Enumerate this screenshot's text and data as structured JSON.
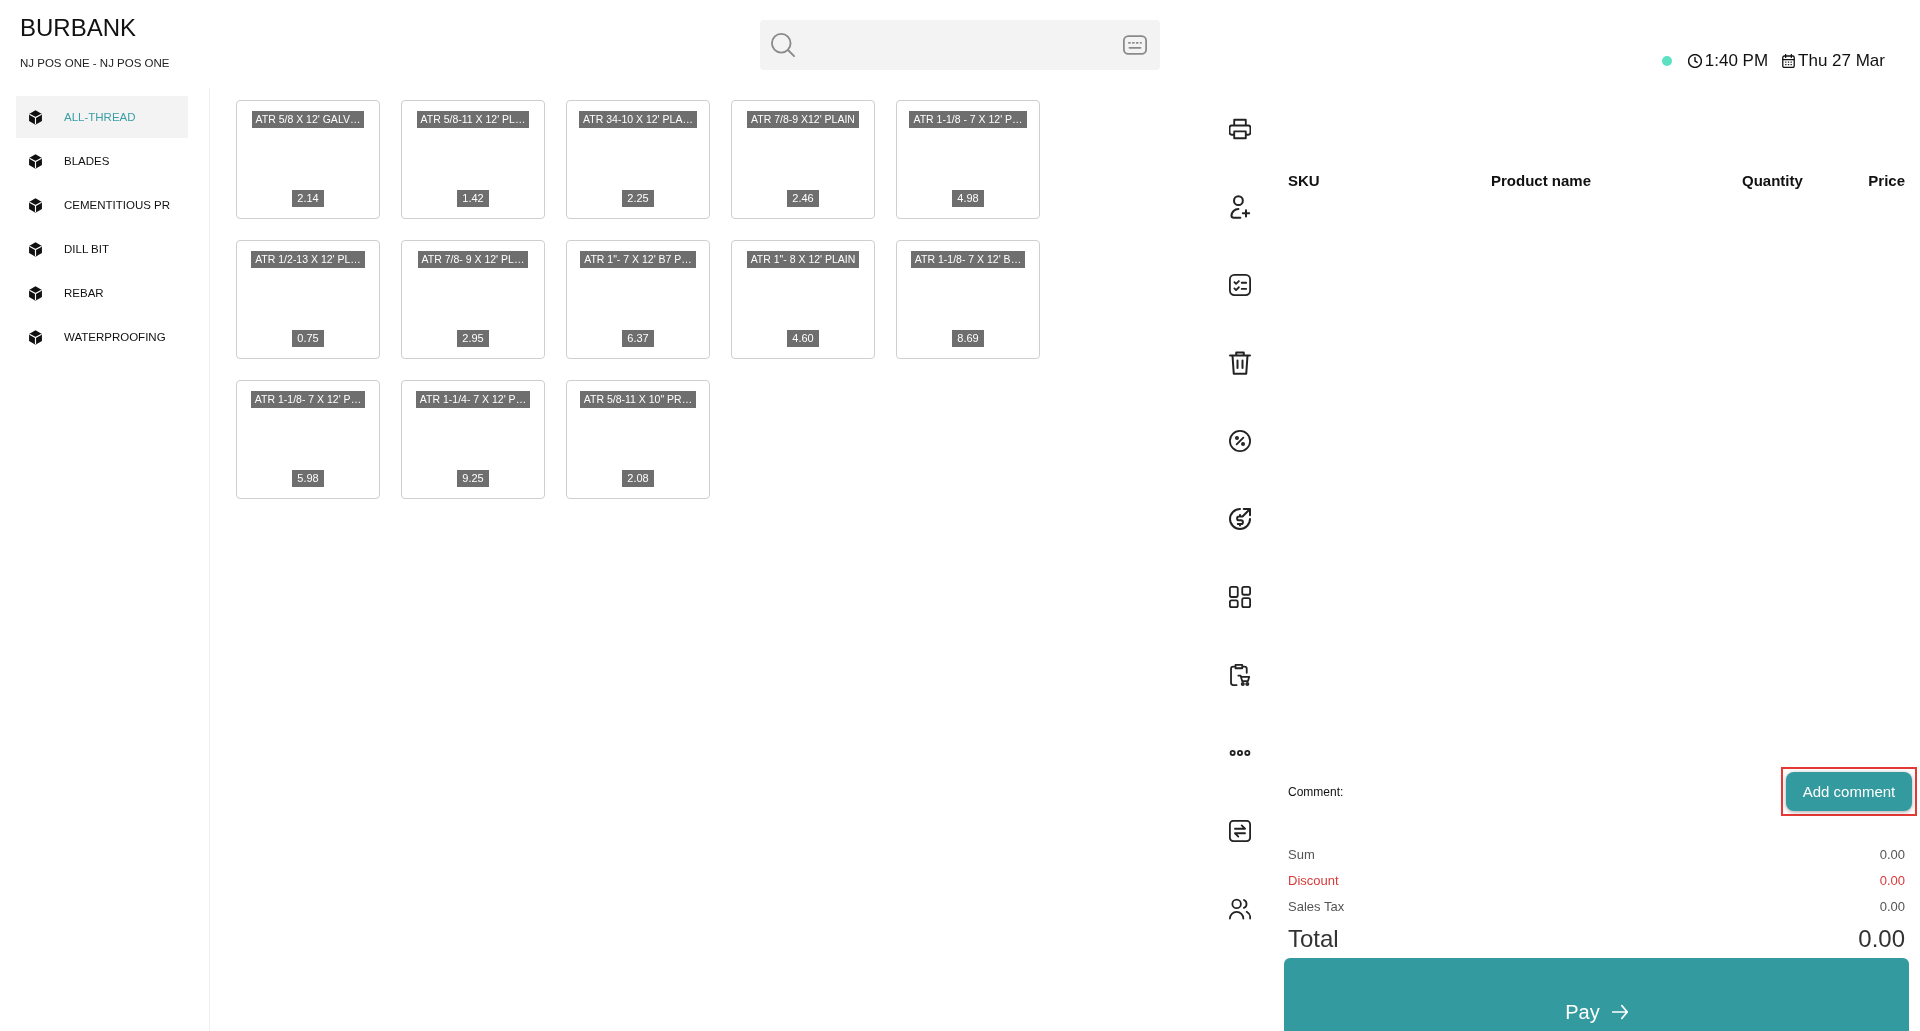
{
  "store": {
    "name": "BURBANK",
    "register": "NJ POS ONE - NJ POS ONE"
  },
  "status": {
    "online": true,
    "time": "1:40 PM",
    "date": "Thu 27 Mar"
  },
  "categories": [
    {
      "label": "ALL-THREAD",
      "selected": true
    },
    {
      "label": "BLADES",
      "selected": false
    },
    {
      "label": "CEMENTITIOUS PR",
      "selected": false
    },
    {
      "label": "DILL BIT",
      "selected": false
    },
    {
      "label": "REBAR",
      "selected": false
    },
    {
      "label": "WATERPROOFING",
      "selected": false
    }
  ],
  "products": [
    {
      "name": "ATR 5/8 X 12' GALV…",
      "price": "2.14"
    },
    {
      "name": "ATR 5/8-11 X 12' PL…",
      "price": "1.42"
    },
    {
      "name": "ATR 34-10 X 12' PLA…",
      "price": "2.25"
    },
    {
      "name": "ATR 7/8-9 X12' PLAIN",
      "price": "2.46"
    },
    {
      "name": "ATR 1-1/8 - 7 X 12' P…",
      "price": "4.98"
    },
    {
      "name": "ATR 1/2-13 X 12' PL…",
      "price": "0.75"
    },
    {
      "name": "ATR 7/8- 9 X 12' PL…",
      "price": "2.95"
    },
    {
      "name": "ATR 1\"- 7 X 12' B7 P…",
      "price": "6.37"
    },
    {
      "name": "ATR 1\"- 8 X 12' PLAIN",
      "price": "4.60"
    },
    {
      "name": "ATR 1-1/8- 7 X 12' B…",
      "price": "8.69"
    },
    {
      "name": "ATR 1-1/8- 7 X 12' P…",
      "price": "5.98"
    },
    {
      "name": "ATR 1-1/4- 7 X 12' P…",
      "price": "9.25"
    },
    {
      "name": "ATR 5/8-11 X 10\" PR…",
      "price": "2.08"
    }
  ],
  "order_table": {
    "columns": [
      "SKU",
      "Product name",
      "Quantity",
      "Price"
    ]
  },
  "comment": {
    "label": "Comment:",
    "button": "Add comment",
    "highlighted": true
  },
  "totals": [
    {
      "kind": "line",
      "label": "Sum",
      "value": "0.00"
    },
    {
      "kind": "discount",
      "label": "Discount",
      "value": "0.00"
    },
    {
      "kind": "line",
      "label": "Sales Tax",
      "value": "0.00"
    }
  ],
  "total": {
    "label": "Total",
    "value": "0.00"
  },
  "pay_button": {
    "label": "Pay"
  }
}
